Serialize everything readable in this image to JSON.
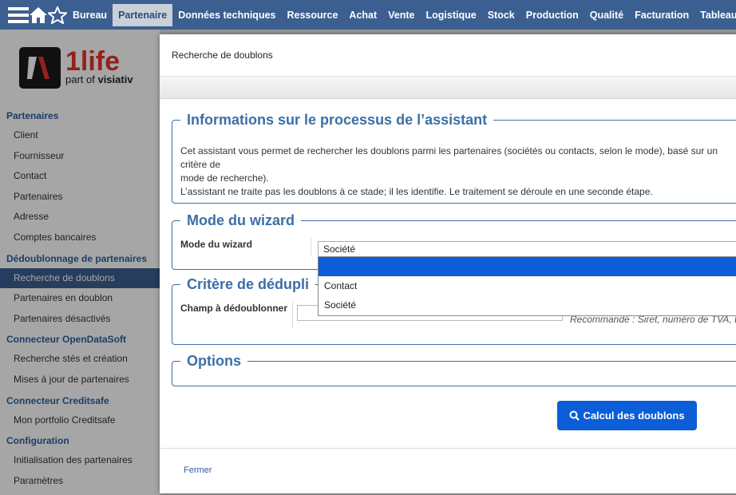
{
  "nav": {
    "items": [
      "Bureau",
      "Partenaire",
      "Données techniques",
      "Ressource",
      "Achat",
      "Vente",
      "Logistique",
      "Stock",
      "Production",
      "Qualité",
      "Facturation",
      "Tableaux d"
    ],
    "active_index": 1
  },
  "logo": {
    "brand": "1life",
    "tagline_pre": "part of ",
    "tagline_brand": "visiativ"
  },
  "sidebar": {
    "sections": [
      {
        "title": "Partenaires",
        "items": [
          "Client",
          "Fournisseur",
          "Contact",
          "Partenaires",
          "Adresse",
          "Comptes bancaires"
        ]
      },
      {
        "title": "Dédoublonnage de partenaires",
        "items": [
          "Recherche de doublons",
          "Partenaires en doublon",
          "Partenaires désactivés"
        ]
      },
      {
        "title": "Connecteur OpenDataSoft",
        "items": [
          "Recherche stés et création",
          "Mises à jour de partenaires"
        ]
      },
      {
        "title": "Connecteur Creditsafe",
        "items": [
          "Mon portfolio Creditsafe"
        ]
      },
      {
        "title": "Configuration",
        "items": [
          "Initialisation des partenaires",
          "Paramètres"
        ]
      }
    ],
    "active_item": "Recherche de doublons"
  },
  "modal": {
    "title": "Recherche de doublons",
    "info": {
      "legend": "Informations sur le processus de l’assistant",
      "line1": "Cet assistant vous permet de rechercher les doublons parmi les partenaires (sociétés ou contacts, selon le mode), basé sur un critère de",
      "line2": "mode de recherche).",
      "line3": "L’assistant ne traite pas les doublons à ce stade; il les identifie. Le traitement se déroule en une seconde étape."
    },
    "mode": {
      "legend": "Mode du wizard",
      "label": "Mode du wizard",
      "value": "Société",
      "options": [
        "",
        "Contact",
        "Société"
      ]
    },
    "criteria": {
      "legend": "Critère de dédupli",
      "label": "Champ à dédoublonner",
      "hint": "Recommandé : Siret, numéro de TVA, té"
    },
    "options": {
      "legend": "Options"
    },
    "compute_button": "Calcul des doublons",
    "close_link": "Fermer"
  },
  "colors": {
    "topbar": "#3b5f90",
    "accent": "#0b5ed7",
    "legend": "#3b6fa8"
  }
}
